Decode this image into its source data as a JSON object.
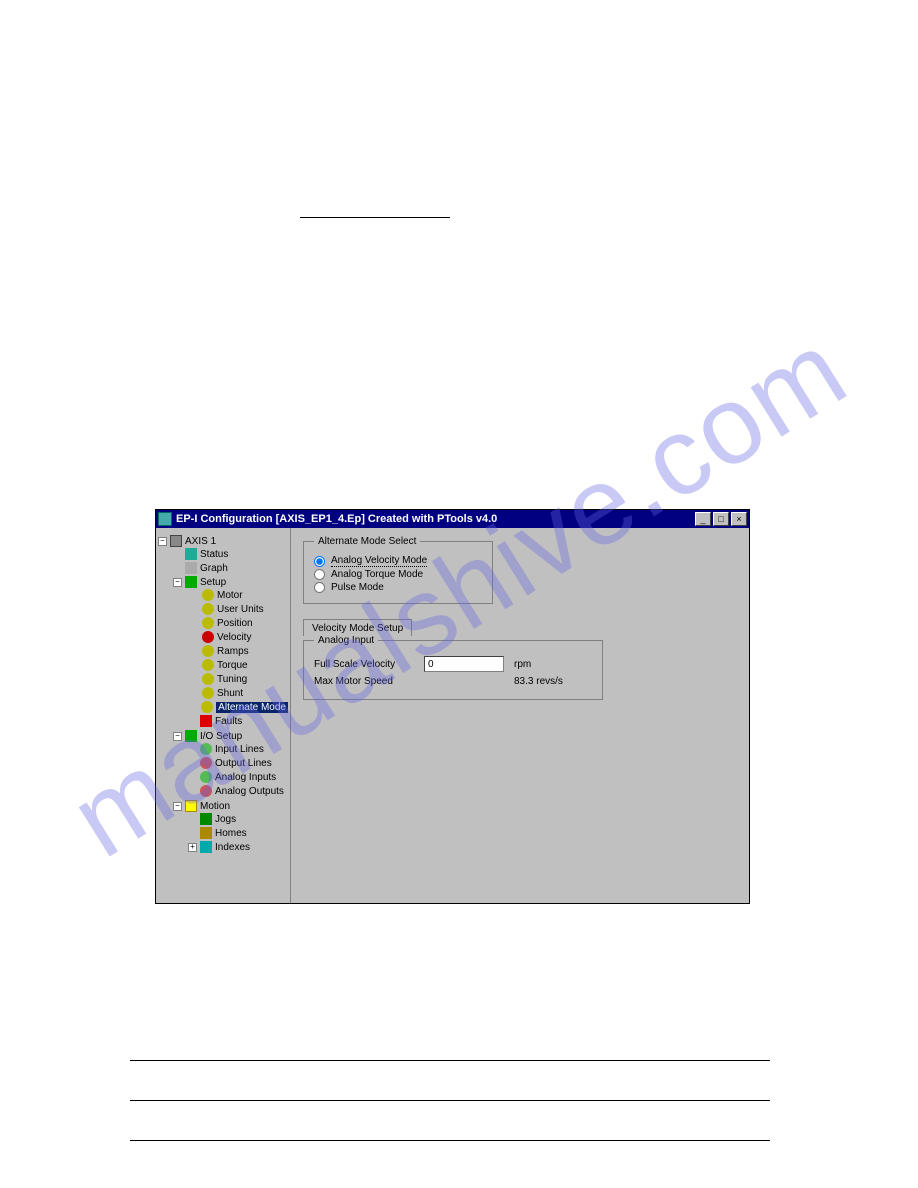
{
  "window": {
    "title": "EP-I Configuration  [AXIS_EP1_4.Ep] Created with PTools v4.0",
    "controls": {
      "min": "_",
      "max": "□",
      "close": "×"
    }
  },
  "tree": {
    "root": "AXIS 1",
    "status": "Status",
    "graph": "Graph",
    "setup": "Setup",
    "setup_items": {
      "motor": "Motor",
      "user_units": "User Units",
      "position": "Position",
      "velocity": "Velocity",
      "ramps": "Ramps",
      "torque": "Torque",
      "tuning": "Tuning",
      "shunt": "Shunt",
      "alternate_mode": "Alternate Mode",
      "faults": "Faults"
    },
    "io_setup": "I/O Setup",
    "io_items": {
      "input_lines": "Input Lines",
      "output_lines": "Output Lines",
      "analog_inputs": "Analog Inputs",
      "analog_outputs": "Analog Outputs"
    },
    "motion": "Motion",
    "motion_items": {
      "jogs": "Jogs",
      "homes": "Homes",
      "indexes": "Indexes"
    }
  },
  "alt_mode": {
    "legend": "Alternate Mode Select",
    "opt_velocity": "Analog Velocity Mode",
    "opt_torque": "Analog Torque Mode",
    "opt_pulse": "Pulse Mode"
  },
  "tab": {
    "vel_setup": "Velocity Mode Setup"
  },
  "analog_input": {
    "legend": "Analog Input",
    "fsv_label": "Full Scale Velocity",
    "fsv_value": "0",
    "fsv_unit": "rpm",
    "mms_label": "Max Motor Speed",
    "mms_value": "83.3  revs/s"
  },
  "watermark": "manualshive.com"
}
